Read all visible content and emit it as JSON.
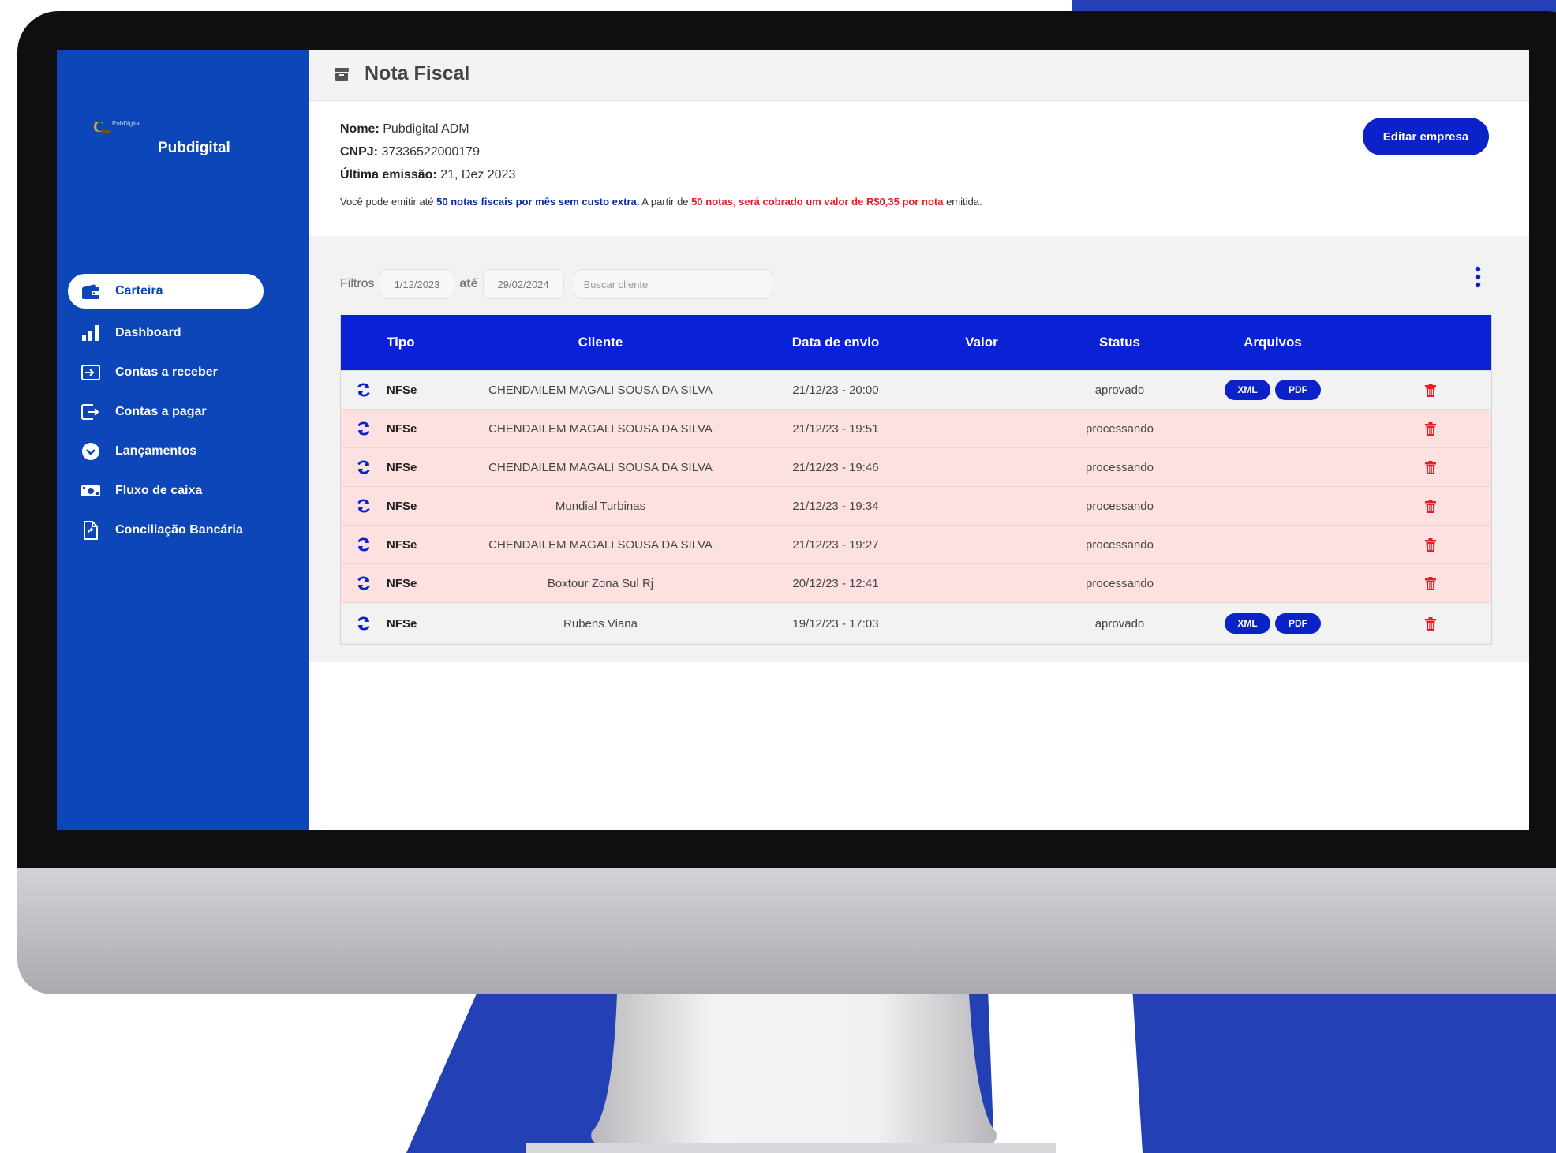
{
  "sidebar": {
    "brand_logo_text": "PubDigital",
    "brand_name": "Pubdigital",
    "items": [
      {
        "label": "Carteira",
        "icon": "wallet-icon",
        "active": true
      },
      {
        "label": "Dashboard",
        "icon": "bar-chart-icon"
      },
      {
        "label": "Contas a receber",
        "icon": "sign-in-icon"
      },
      {
        "label": "Contas a pagar",
        "icon": "sign-out-icon"
      },
      {
        "label": "Lançamentos",
        "icon": "chevron-circle-icon"
      },
      {
        "label": "Fluxo de caixa",
        "icon": "money-icon"
      },
      {
        "label": "Conciliação Bancária",
        "icon": "file-sync-icon"
      }
    ]
  },
  "header": {
    "title": "Nota Fiscal",
    "icon": "archive-icon"
  },
  "company": {
    "nome_label": "Nome:",
    "nome": "Pubdigital ADM",
    "cnpj_label": "CNPJ:",
    "cnpj": "37336522000179",
    "ultima_label": "Última emissão:",
    "ultima": "21, Dez 2023",
    "notice_1": "Você pode emitir até ",
    "notice_2": "50 notas fiscais por mês sem custo extra.",
    "notice_3": " A partir de ",
    "notice_4": "50 notas, será cobrado um valor de R$0,35 por nota",
    "notice_5": " emitida.",
    "edit_button": "Editar empresa"
  },
  "filters": {
    "label": "Filtros",
    "date_from": "1/12/2023",
    "sep": "até",
    "date_to": "29/02/2024",
    "search_placeholder": "Buscar cliente"
  },
  "table": {
    "headers": {
      "tipo": "Tipo",
      "cliente": "Cliente",
      "data": "Data de envio",
      "valor": "Valor",
      "status": "Status",
      "arquivos": "Arquivos"
    },
    "xml_label": "XML",
    "pdf_label": "PDF",
    "rows": [
      {
        "tipo": "NFSe",
        "cliente": "CHENDAILEM MAGALI SOUSA DA SILVA",
        "data": "21/12/23 - 20:00",
        "valor": "",
        "status": "aprovado"
      },
      {
        "tipo": "NFSe",
        "cliente": "CHENDAILEM MAGALI SOUSA DA SILVA",
        "data": "21/12/23 - 19:51",
        "valor": "",
        "status": "processando"
      },
      {
        "tipo": "NFSe",
        "cliente": "CHENDAILEM MAGALI SOUSA DA SILVA",
        "data": "21/12/23 - 19:46",
        "valor": "",
        "status": "processando"
      },
      {
        "tipo": "NFSe",
        "cliente": "Mundial Turbinas",
        "data": "21/12/23 - 19:34",
        "valor": "",
        "status": "processando"
      },
      {
        "tipo": "NFSe",
        "cliente": "CHENDAILEM MAGALI SOUSA DA SILVA",
        "data": "21/12/23 - 19:27",
        "valor": "",
        "status": "processando"
      },
      {
        "tipo": "NFSe",
        "cliente": "Boxtour Zona Sul Rj",
        "data": "20/12/23 - 12:41",
        "valor": "",
        "status": "processando"
      },
      {
        "tipo": "NFSe",
        "cliente": "Rubens Viana",
        "data": "19/12/23 - 17:03",
        "valor": "",
        "status": "aprovado"
      }
    ]
  },
  "colors": {
    "sidebar": "#0c46b8",
    "table_header": "#0a22d6",
    "button": "#0a22c8",
    "row_pending": "#fde0e0",
    "delete": "#e41e26",
    "backdrop_blue": "#2341b4"
  }
}
